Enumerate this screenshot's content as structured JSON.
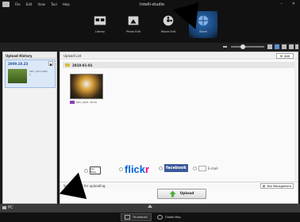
{
  "app": {
    "title": "Intelli-studio"
  },
  "menu": [
    "File",
    "Edit",
    "View",
    "Tool",
    "Help"
  ],
  "modes": [
    {
      "label": "Library",
      "icon": "library-icon"
    },
    {
      "label": "Photo Edit",
      "icon": "photo-edit-icon"
    },
    {
      "label": "Movie Edit",
      "icon": "movie-edit-icon"
    },
    {
      "label": "Share",
      "icon": "share-icon",
      "active": true
    }
  ],
  "left_panel": {
    "title": "Upload History",
    "date": "2009.10.23",
    "meta_line1": "SDV_0071.MP4",
    "meta_line2": "1"
  },
  "main": {
    "title": "Upload List",
    "add_label": "Add",
    "group_date": "2010-01-01",
    "item_name": "SDV_0009",
    "item_duration": "00:00",
    "site_prompt": "Select a site for uploading.",
    "site_mgmt_label": "Site Management"
  },
  "sites": {
    "youtube_label": "You Tube",
    "flickr_a": "flick",
    "flickr_b": "r",
    "facebook_label": "facebook",
    "email_label": "E-mail"
  },
  "upload_button": {
    "label": "Upload"
  },
  "bottom": {
    "pc_label": "PC"
  },
  "footer_tabs": [
    {
      "label": "Thumbnail"
    },
    {
      "label": "Global Map"
    }
  ],
  "colors": {
    "share_active": "#2b6db6",
    "flickr_blue": "#0063dc",
    "flickr_pink": "#ff0084",
    "facebook": "#3b5998",
    "upload_arrow": "#4fae3b"
  }
}
